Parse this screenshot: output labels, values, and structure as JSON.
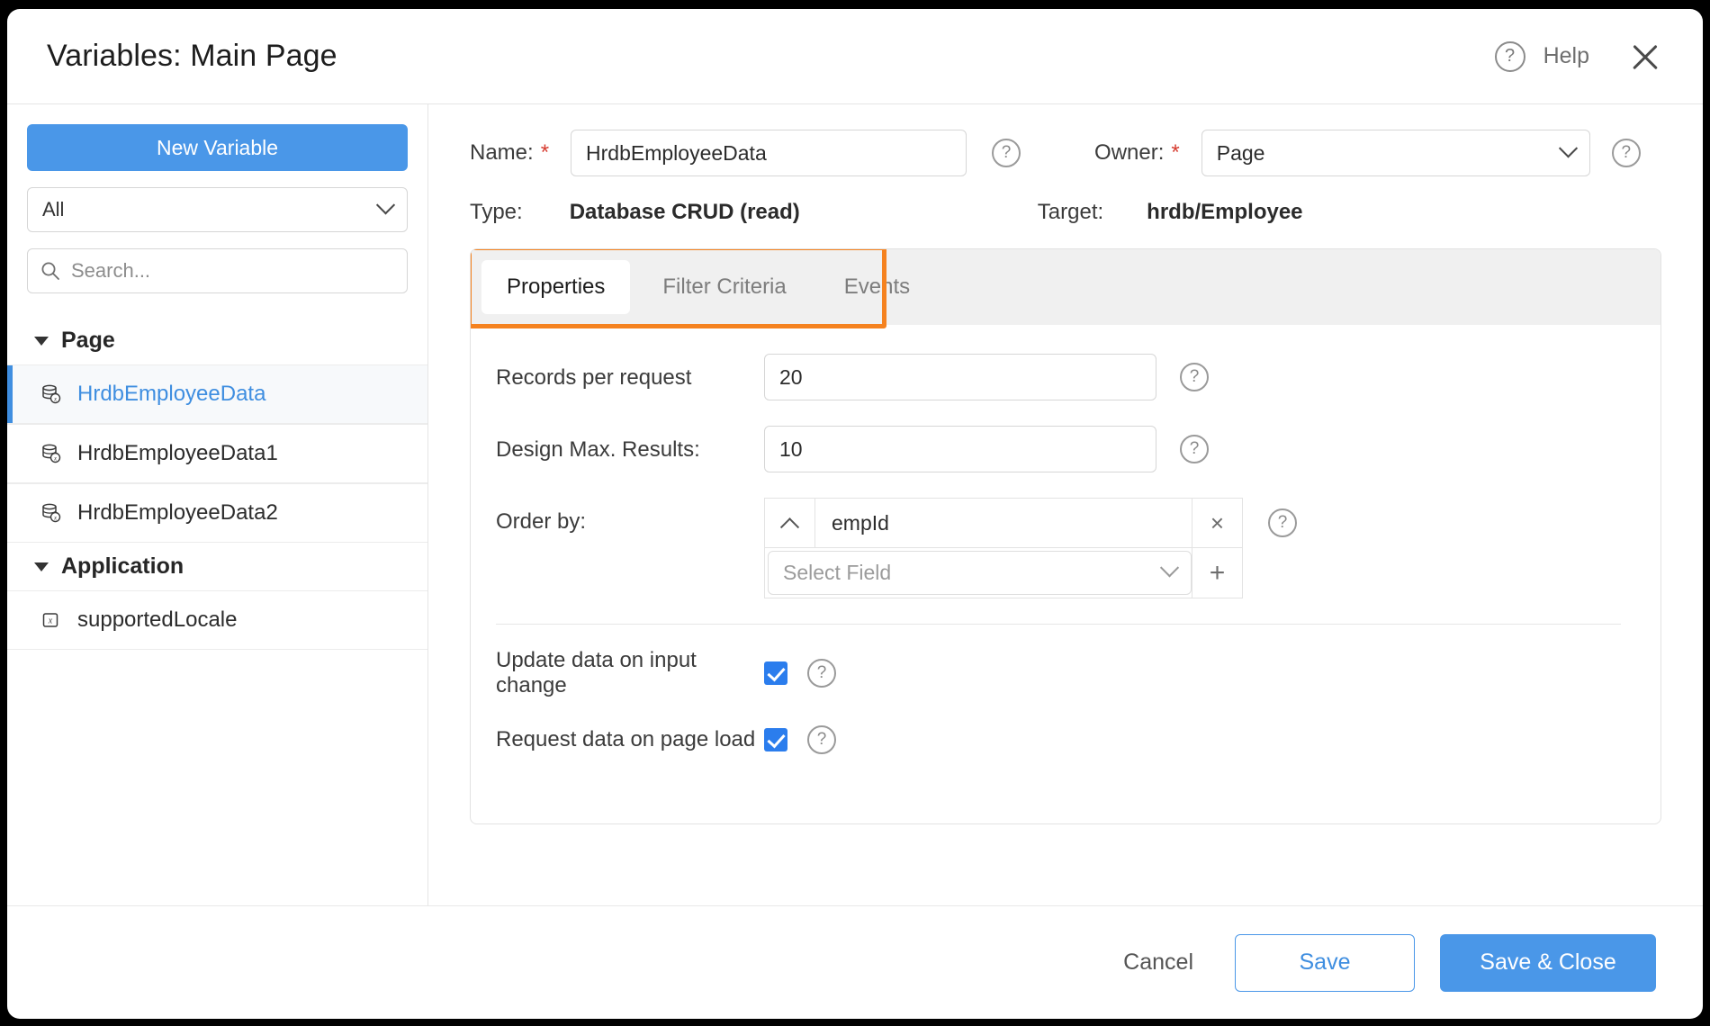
{
  "header": {
    "title": "Variables: Main Page",
    "help_label": "Help",
    "help_icon": "question-circle-icon",
    "close_icon": "close-icon"
  },
  "sidebar": {
    "new_variable_label": "New Variable",
    "filter_value": "All",
    "search_placeholder": "Search...",
    "search_icon": "search-icon",
    "groups": [
      {
        "label": "Page",
        "items": [
          {
            "label": "HrdbEmployeeData",
            "icon": "database-variable-icon",
            "selected": true
          },
          {
            "label": "HrdbEmployeeData1",
            "icon": "database-variable-icon",
            "selected": false
          },
          {
            "label": "HrdbEmployeeData2",
            "icon": "database-variable-icon",
            "selected": false
          }
        ]
      },
      {
        "label": "Application",
        "items": [
          {
            "label": "supportedLocale",
            "icon": "variable-x-icon",
            "selected": false
          }
        ]
      }
    ]
  },
  "form": {
    "name_label": "Name:",
    "name_value": "HrdbEmployeeData",
    "owner_label": "Owner:",
    "owner_value": "Page",
    "type_label": "Type:",
    "type_value": "Database CRUD (read)",
    "target_label": "Target:",
    "target_value": "hrdb/Employee",
    "required_marker": "*"
  },
  "tabs": [
    {
      "label": "Properties",
      "active": true
    },
    {
      "label": "Filter Criteria",
      "active": false
    },
    {
      "label": "Events",
      "active": false
    }
  ],
  "properties": {
    "records_per_request": {
      "label": "Records per request",
      "value": "20"
    },
    "design_max_results": {
      "label": "Design Max. Results:",
      "value": "10"
    },
    "order_by": {
      "label": "Order by:",
      "sort_direction": "ascending",
      "field": "empId",
      "remove_icon": "×",
      "select_placeholder": "Select Field",
      "add_icon": "+"
    },
    "update_on_input_change": {
      "label": "Update data on input change",
      "checked": true
    },
    "request_on_page_load": {
      "label": "Request data on page load",
      "checked": true
    }
  },
  "footer": {
    "cancel_label": "Cancel",
    "save_label": "Save",
    "save_close_label": "Save & Close"
  },
  "colors": {
    "accent_blue": "#4a97e8",
    "annotation_orange": "#f5821f",
    "required_red": "#d63b2f",
    "checkbox_blue": "#2b7ded"
  }
}
